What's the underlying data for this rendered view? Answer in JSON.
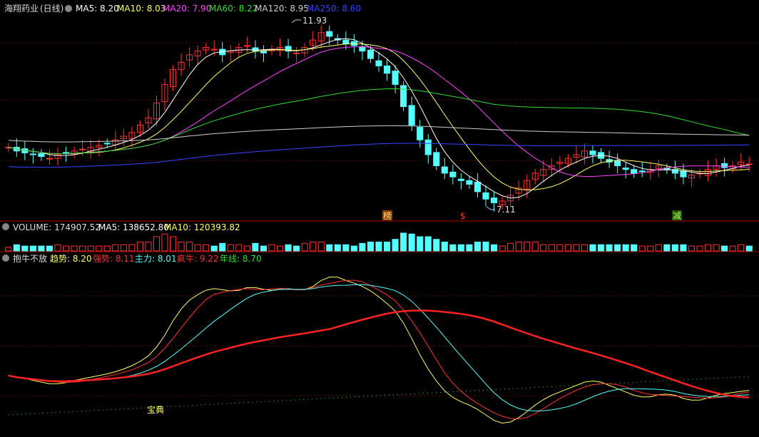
{
  "header": {
    "stock": "海翔药业",
    "period": "(日线)",
    "ma5": "MA5: 8.20",
    "ma10": "MA10: 8.03",
    "ma20": "MA20: 7.90",
    "ma60": "MA60: 8.22",
    "ma120": "MA120: 8.95",
    "ma250": "MA250: 8.60"
  },
  "annotations": {
    "high": "11.93",
    "low": "7.11",
    "tag1": "榜",
    "tag2": "$",
    "tag3": "减"
  },
  "volume_header": {
    "volume": "VOLUME: 174907.52",
    "ma5": "MA5: 138652.80",
    "ma10": "MA10: 120393.82"
  },
  "indicator_header": {
    "name": "抱牛不放",
    "trend": "趋势: 8.20",
    "strong": "强势: 8.11",
    "main": "主力: 8.01",
    "crazy": "疯牛: 9.22",
    "year": "年线: 8.70"
  },
  "indicator_label": "宝典",
  "colors": {
    "up": "#ff3333",
    "down": "#54ffff",
    "ma5": "#ffffff",
    "ma10": "#ffff66",
    "ma20": "#ff44ff",
    "ma60": "#33dd33",
    "ma120": "#cccccc",
    "ma250": "#3344ff",
    "panel_border": "#aa0000"
  },
  "chart_data": [
    {
      "type": "candlestick",
      "title": "海翔药业 (日线)",
      "ylim": [
        6.9,
        12.2
      ],
      "high_marker": 11.93,
      "low_marker": 7.11,
      "close": [
        8.7,
        8.6,
        8.55,
        8.5,
        8.45,
        8.4,
        8.5,
        8.55,
        8.6,
        8.65,
        8.7,
        8.75,
        8.8,
        8.9,
        9.0,
        9.1,
        9.3,
        9.5,
        9.9,
        10.4,
        10.8,
        11.0,
        11.2,
        11.3,
        11.4,
        11.35,
        11.2,
        11.3,
        11.4,
        11.45,
        11.3,
        11.25,
        11.35,
        11.4,
        11.3,
        11.25,
        11.4,
        11.6,
        11.8,
        11.7,
        11.6,
        11.5,
        11.45,
        11.3,
        11.1,
        10.9,
        10.7,
        10.4,
        9.8,
        9.3,
        8.9,
        8.5,
        8.2,
        8.0,
        7.9,
        7.8,
        7.7,
        7.5,
        7.3,
        7.2,
        7.25,
        7.4,
        7.6,
        7.8,
        8.0,
        8.1,
        8.2,
        8.3,
        8.4,
        8.5,
        8.6,
        8.5,
        8.4,
        8.3,
        8.2,
        8.1,
        8.0,
        8.05,
        8.1,
        8.2,
        8.1,
        8.0,
        7.9,
        7.95,
        8.0,
        8.1,
        8.2,
        8.15,
        8.2,
        8.3,
        8.25
      ],
      "ma5_last": 8.2,
      "ma10_last": 8.03,
      "ma20_last": 7.9,
      "ma60_last": 8.22,
      "ma120_last": 8.95,
      "ma250_last": 8.6
    },
    {
      "type": "bar",
      "title": "VOLUME",
      "last_volume": 174907.52,
      "ma5_last": 138652.8,
      "ma10_last": 120393.82
    },
    {
      "type": "line",
      "title": "抱牛不放",
      "series": [
        {
          "name": "趋势",
          "last": 8.2
        },
        {
          "name": "强势",
          "last": 8.11
        },
        {
          "name": "主力",
          "last": 8.01
        },
        {
          "name": "疯牛",
          "last": 9.22
        },
        {
          "name": "年线",
          "last": 8.7
        }
      ]
    }
  ]
}
